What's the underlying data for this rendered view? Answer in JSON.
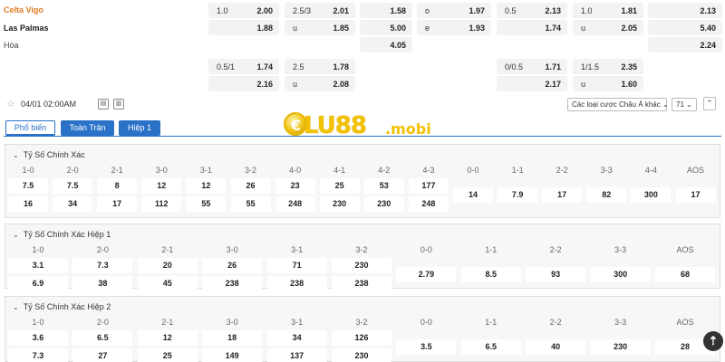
{
  "teams": {
    "home": "Celta Vigo",
    "away": "Las Palmas",
    "draw": "Hòa"
  },
  "top_rows": [
    [
      {
        "l": "1.0",
        "v": "2.00"
      },
      {
        "l": "2.5/3",
        "v": "2.01"
      },
      {
        "l": "",
        "v": "1.58"
      },
      {
        "l": "o",
        "v": "1.97"
      },
      {
        "l": "0.5",
        "v": "2.13"
      },
      {
        "l": "1.0",
        "v": "1.81"
      },
      {
        "l": "",
        "v": "2.13"
      }
    ],
    [
      {
        "l": "",
        "v": "1.88"
      },
      {
        "l": "u",
        "v": "1.85"
      },
      {
        "l": "",
        "v": "5.00"
      },
      {
        "l": "e",
        "v": "1.93"
      },
      {
        "l": "",
        "v": "1.74"
      },
      {
        "l": "u",
        "v": "2.05"
      },
      {
        "l": "",
        "v": "5.40"
      }
    ],
    [
      null,
      null,
      {
        "l": "",
        "v": "4.05"
      },
      null,
      null,
      null,
      {
        "l": "",
        "v": "2.24"
      }
    ],
    [
      {
        "l": "0.5/1",
        "v": "1.74"
      },
      {
        "l": "2.5",
        "v": "1.78"
      },
      null,
      null,
      {
        "l": "0/0.5",
        "v": "1.71"
      },
      {
        "l": "1/1.5",
        "v": "2.35"
      },
      null
    ],
    [
      {
        "l": "",
        "v": "2.16"
      },
      {
        "l": "u",
        "v": "2.08"
      },
      null,
      null,
      {
        "l": "",
        "v": "2.17"
      },
      {
        "l": "u",
        "v": "1.60"
      },
      null
    ]
  ],
  "controls": {
    "datetime": "04/01 02:00AM",
    "odds_type": "Các loại cược Châu Á khác",
    "count": "71"
  },
  "tabs": [
    "Phổ biến",
    "Toàn Trận",
    "Hiệp 1"
  ],
  "logo": {
    "brand": "LU88",
    "domain": ".mobi"
  },
  "sections": [
    {
      "title": "Tỷ Số Chính Xác",
      "headers": [
        "1-0",
        "2-0",
        "2-1",
        "3-0",
        "3-1",
        "3-2",
        "4-0",
        "4-1",
        "4-2",
        "4-3",
        "0-0",
        "1-1",
        "2-2",
        "3-3",
        "4-4",
        "AOS"
      ],
      "row1": [
        "7.5",
        "7.5",
        "8",
        "12",
        "12",
        "26",
        "23",
        "25",
        "53",
        "177"
      ],
      "row2": [
        "16",
        "34",
        "17",
        "112",
        "55",
        "55",
        "248",
        "230",
        "230",
        "248"
      ],
      "mid": [
        "14",
        "7.9",
        "17",
        "82",
        "300",
        "17"
      ]
    },
    {
      "title": "Tỷ Số Chính Xác Hiệp 1",
      "headers": [
        "1-0",
        "2-0",
        "2-1",
        "3-0",
        "3-1",
        "3-2",
        "0-0",
        "1-1",
        "2-2",
        "3-3",
        "AOS"
      ],
      "row1": [
        "3.1",
        "7.3",
        "20",
        "26",
        "71",
        "230"
      ],
      "row2": [
        "6.9",
        "38",
        "45",
        "238",
        "238",
        "238"
      ],
      "mid": [
        "2.79",
        "8.5",
        "93",
        "300",
        "68"
      ]
    },
    {
      "title": "Tỷ Số Chính Xác Hiệp 2",
      "headers": [
        "1-0",
        "2-0",
        "2-1",
        "3-0",
        "3-1",
        "3-2",
        "0-0",
        "1-1",
        "2-2",
        "3-3",
        "AOS"
      ],
      "row1": [
        "3.6",
        "6.5",
        "12",
        "18",
        "34",
        "126"
      ],
      "row2": [
        "7.3",
        "27",
        "25",
        "149",
        "137",
        "230"
      ],
      "mid": [
        "3.5",
        "6.5",
        "40",
        "230",
        "28"
      ]
    }
  ]
}
